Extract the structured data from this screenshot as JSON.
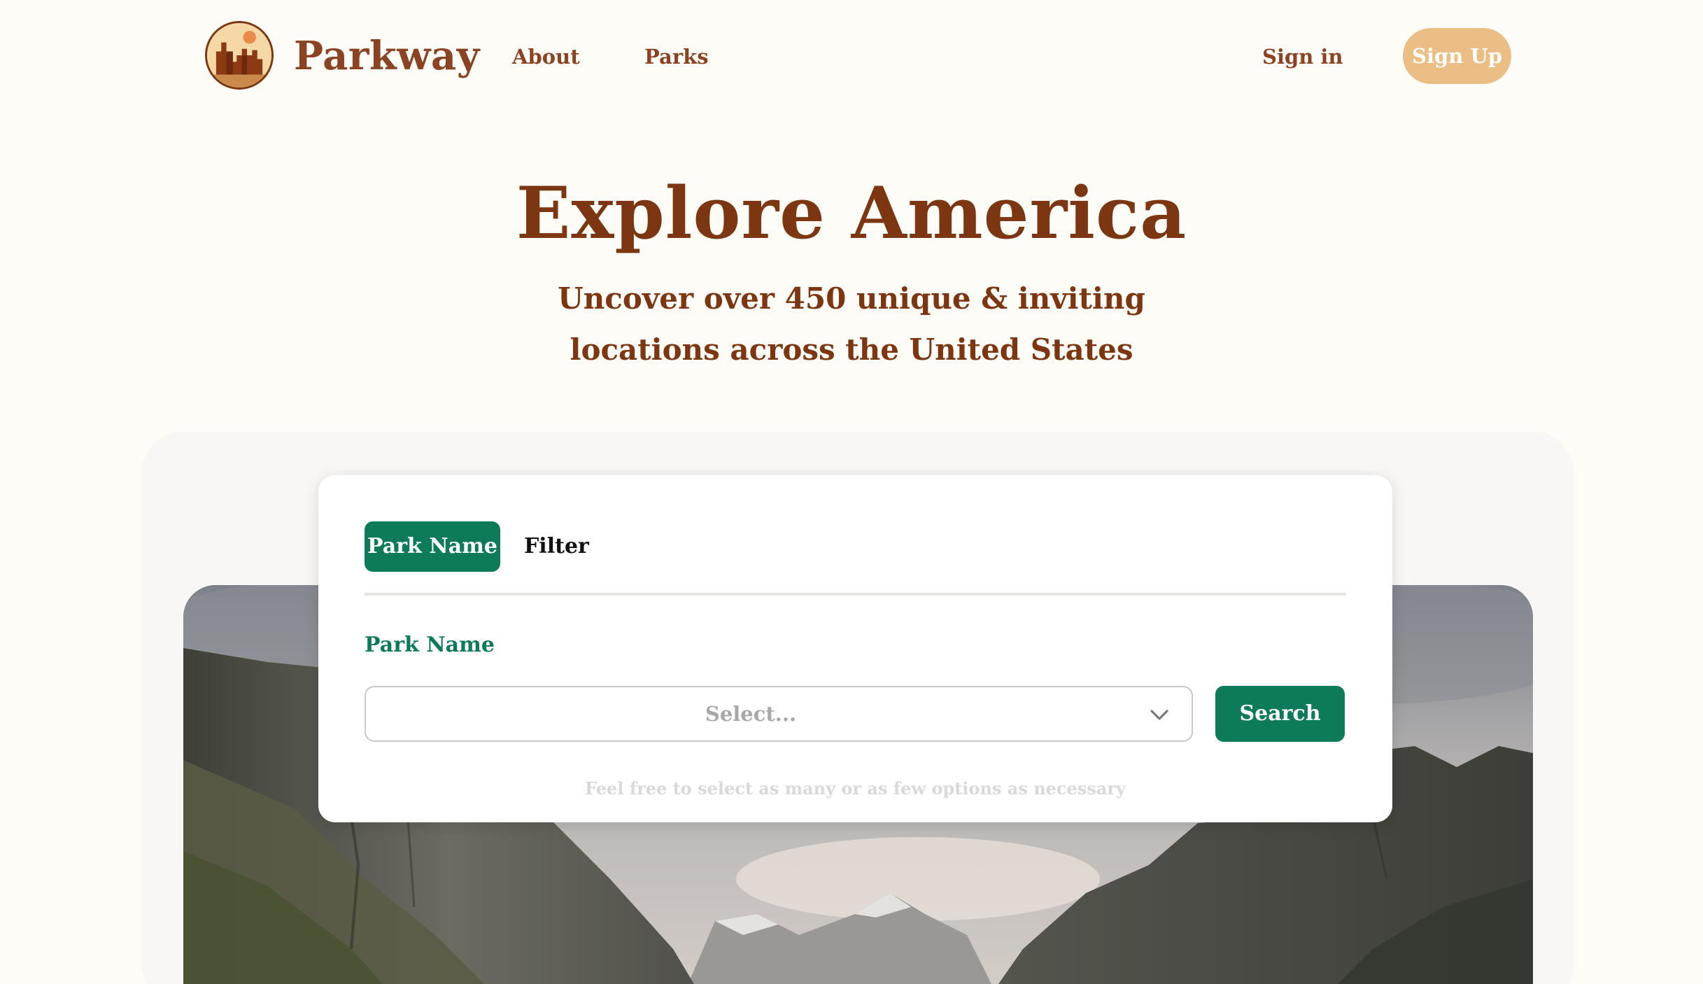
{
  "nav": {
    "brand": "Parkway",
    "logo_icon": "mesa-logo-icon",
    "links": [
      {
        "label": "About"
      },
      {
        "label": "Parks"
      }
    ],
    "sign_in": "Sign in",
    "sign_up": "Sign Up"
  },
  "hero": {
    "title": "Explore America",
    "subtitle_line1": "Uncover over 450 unique & inviting",
    "subtitle_line2": "locations across the United States"
  },
  "search": {
    "tabs": [
      {
        "label": "Park Name",
        "active": true
      },
      {
        "label": "Filter",
        "active": false
      }
    ],
    "field_label": "Park Name",
    "select_placeholder": "Select...",
    "dropdown_icon": "chevron-down-icon",
    "button_label": "Search",
    "hint": "Feel free to select as many or as few options as necessary"
  },
  "colors": {
    "brand_brown": "#7D3612",
    "accent_green": "#0D7A5A",
    "sign_up_bg": "#EBBE86",
    "page_bg": "#FDFCF6"
  }
}
